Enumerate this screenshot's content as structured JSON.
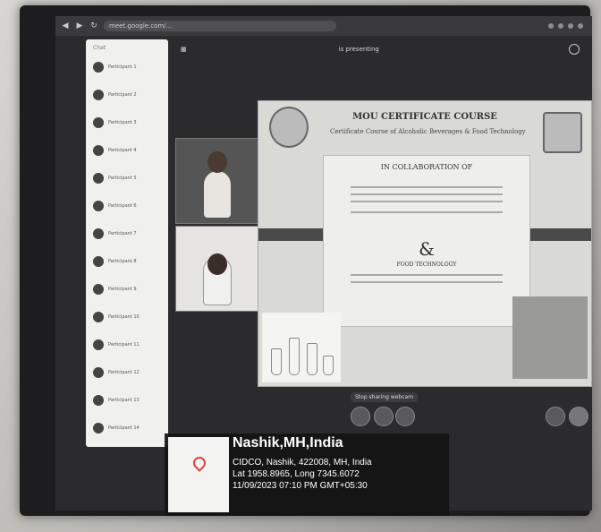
{
  "browser": {
    "url": "meet.google.com/..."
  },
  "sidebar": {
    "heading": "Chat",
    "items": [
      {
        "label": "Participant 1"
      },
      {
        "label": "Participant 2"
      },
      {
        "label": "Participant 3"
      },
      {
        "label": "Participant 4"
      },
      {
        "label": "Participant 5"
      },
      {
        "label": "Participant 6"
      },
      {
        "label": "Participant 7"
      },
      {
        "label": "Participant 8"
      },
      {
        "label": "Participant 9"
      },
      {
        "label": "Participant 10"
      },
      {
        "label": "Participant 11"
      },
      {
        "label": "Participant 12"
      },
      {
        "label": "Participant 13"
      },
      {
        "label": "Participant 14"
      }
    ]
  },
  "meeting": {
    "presenter_label": "is presenting"
  },
  "slide": {
    "title": "MOU CERTIFICATE COURSE",
    "subtitle": "Certificate Course of Alcoholic Beverages & Food Technology",
    "collab": "IN COLLABORATION OF",
    "ampersand": "&",
    "dept": "FOOD TECHNOLOGY"
  },
  "controls": {
    "stop_presenting": "Stop sharing webcam"
  },
  "geo_overlay": {
    "place": "Nashik,MH,India",
    "address": "CIDCO, Nashik, 422008, MH, India",
    "coords": "Lat 1958.8965, Long 7345.6072",
    "timestamp": "11/09/2023 07:10 PM GMT+05:30"
  }
}
